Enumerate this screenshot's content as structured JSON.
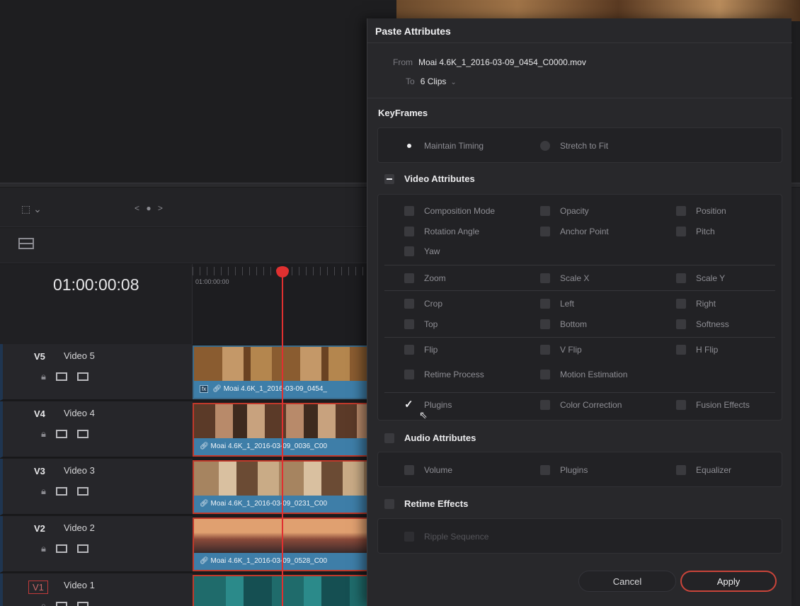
{
  "timeline": {
    "timecode": "01:00:00:08",
    "ruler_label": "01:00:00:00",
    "nav": "< ● >"
  },
  "tracks": [
    {
      "id": "V5",
      "name": "Video 5"
    },
    {
      "id": "V4",
      "name": "Video 4"
    },
    {
      "id": "V3",
      "name": "Video 3"
    },
    {
      "id": "V2",
      "name": "Video 2"
    },
    {
      "id": "V1",
      "name": "Video 1"
    }
  ],
  "clips": [
    {
      "label": "Moai 4.6K_1_2016-03-09_0454_",
      "badge": "fx"
    },
    {
      "label": "Moai 4.6K_1_2016-03-09_0036_C00"
    },
    {
      "label": "Moai 4.6K_1_2016-03-09_0231_C00"
    },
    {
      "label": "Moai 4.6K_1_2016-03-09_0528_C00"
    }
  ],
  "dialog": {
    "title": "Paste Attributes",
    "from_label": "From",
    "from_value": "Moai 4.6K_1_2016-03-09_0454_C0000.mov",
    "to_label": "To",
    "to_value": "6 Clips",
    "keyframes": {
      "title": "KeyFrames",
      "maintain_timing": "Maintain Timing",
      "stretch_to_fit": "Stretch to Fit"
    },
    "video": {
      "title": "Video Attributes",
      "composition_mode": "Composition Mode",
      "opacity": "Opacity",
      "position": "Position",
      "rotation_angle": "Rotation Angle",
      "anchor_point": "Anchor Point",
      "pitch": "Pitch",
      "yaw": "Yaw",
      "zoom": "Zoom",
      "scale_x": "Scale X",
      "scale_y": "Scale Y",
      "crop": "Crop",
      "left": "Left",
      "right": "Right",
      "top": "Top",
      "bottom": "Bottom",
      "softness": "Softness",
      "flip": "Flip",
      "v_flip": "V Flip",
      "h_flip": "H Flip",
      "retime_process": "Retime Process",
      "motion_estimation": "Motion Estimation",
      "plugins": "Plugins",
      "color_correction": "Color Correction",
      "fusion_effects": "Fusion Effects"
    },
    "audio": {
      "title": "Audio Attributes",
      "volume": "Volume",
      "plugins": "Plugins",
      "equalizer": "Equalizer"
    },
    "retime": {
      "title": "Retime Effects",
      "ripple_sequence": "Ripple Sequence"
    },
    "cancel": "Cancel",
    "apply": "Apply"
  }
}
